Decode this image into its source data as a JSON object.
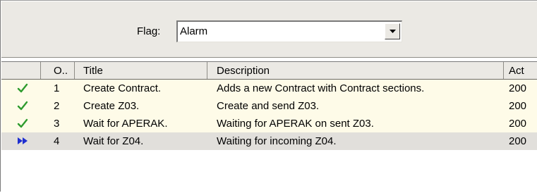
{
  "filter": {
    "label": "Flag:",
    "value": "Alarm",
    "dropdown_icon": "chevron-down-icon"
  },
  "grid": {
    "columns": [
      "",
      "O..",
      "Title",
      "Description",
      "Act"
    ],
    "rows": [
      {
        "status": "check-icon",
        "order": "1",
        "title": "Create Contract.",
        "description": "Adds a new Contract with Contract sections.",
        "act": "200",
        "selected": false
      },
      {
        "status": "check-icon",
        "order": "2",
        "title": "Create Z03.",
        "description": "Create and send Z03.",
        "act": "200",
        "selected": false
      },
      {
        "status": "check-icon",
        "order": "3",
        "title": "Wait for APERAK.",
        "description": "Waiting for APERAK on sent Z03.",
        "act": "200",
        "selected": false
      },
      {
        "status": "fast-forward-icon",
        "order": "4",
        "title": "Wait for Z04.",
        "description": "Waiting for incoming Z04.",
        "act": "200",
        "selected": true
      }
    ]
  },
  "colors": {
    "check": "#2e9b2e",
    "fast_forward": "#1f2fd0",
    "row_bg": "#fefbe8",
    "selected_bg": "#e1dfdb",
    "panel_bg": "#ebe9e4"
  }
}
